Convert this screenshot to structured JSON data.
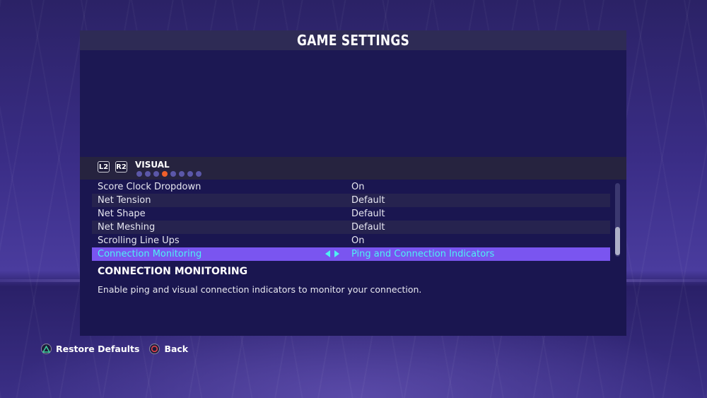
{
  "screen": {
    "title": "GAME SETTINGS"
  },
  "tabs": {
    "left_shoulder": "L2",
    "right_shoulder": "R2",
    "current_tab": "VISUAL",
    "page_count": 8,
    "active_page": 3
  },
  "settings": [
    {
      "label": "Score Clock Dropdown",
      "value": "On"
    },
    {
      "label": "Net Tension",
      "value": "Default"
    },
    {
      "label": "Net Shape",
      "value": "Default"
    },
    {
      "label": "Net Meshing",
      "value": "Default"
    },
    {
      "label": "Scrolling Line Ups",
      "value": "On"
    },
    {
      "label": "Connection Monitoring",
      "value": "Ping and Connection Indicators",
      "selected": true
    }
  ],
  "description": {
    "title": "CONNECTION MONITORING",
    "text": "Enable ping and visual connection indicators to monitor your connection."
  },
  "footer": {
    "restore_defaults": "Restore Defaults",
    "back": "Back"
  },
  "colors": {
    "accent_orange": "#f0602a",
    "selected_row": "#7a55f0",
    "selected_text": "#4ef2f2",
    "triangle_icon": "#3fd2a0",
    "circle_icon": "#e0444a"
  },
  "icons": [
    "triangle-button-icon",
    "circle-button-icon",
    "arrow-left-icon",
    "arrow-right-icon"
  ]
}
